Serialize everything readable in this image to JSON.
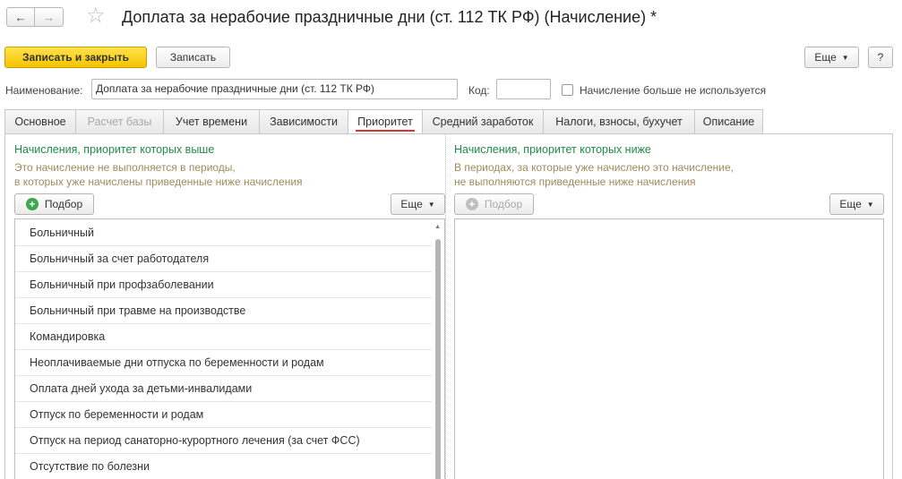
{
  "window": {
    "back_glyph": "←",
    "forward_glyph": "→",
    "star_glyph": "☆",
    "title": "Доплата за нерабочие праздничные дни (ст. 112 ТК РФ) (Начисление) *"
  },
  "toolbar": {
    "save_close_label": "Записать и закрыть",
    "save_label": "Записать",
    "more_label": "Еще",
    "help_label": "?"
  },
  "form": {
    "name_label": "Наименование:",
    "name_value": "Доплата за нерабочие праздничные дни (ст. 112 ТК РФ)",
    "code_label": "Код:",
    "code_value": "",
    "unused_label": "Начисление больше не используется",
    "unused_checked": false
  },
  "tabs": [
    {
      "label": "Основное",
      "state": "normal"
    },
    {
      "label": "Расчет базы",
      "state": "disabled"
    },
    {
      "label": "Учет времени",
      "state": "normal"
    },
    {
      "label": "Зависимости",
      "state": "normal"
    },
    {
      "label": "Приоритет",
      "state": "active"
    },
    {
      "label": "Средний заработок",
      "state": "normal"
    },
    {
      "label": "Налоги, взносы, бухучет",
      "state": "normal"
    },
    {
      "label": "Описание",
      "state": "normal"
    }
  ],
  "left": {
    "title": "Начисления, приоритет которых выше",
    "desc_line1": "Это начисление не выполняется в периоды,",
    "desc_line2": "в которых уже начислены приведенные ниже начисления",
    "pick_label": "Подбор",
    "more_label": "Еще",
    "items": [
      "Больничный",
      "Больничный за счет работодателя",
      "Больничный при профзаболевании",
      "Больничный при травме на производстве",
      "Командировка",
      "Неоплачиваемые дни отпуска по беременности и родам",
      "Оплата дней ухода за детьми-инвалидами",
      "Отпуск по беременности и родам",
      "Отпуск на период санаторно-курортного лечения (за счет ФСС)",
      "Отсутствие по болезни"
    ]
  },
  "right": {
    "title": "Начисления, приоритет которых ниже",
    "desc_line1": "В периодах, за которые уже начислено это начисление,",
    "desc_line2": "не выполняются приведенные ниже начисления",
    "pick_label": "Подбор",
    "more_label": "Еще",
    "items": []
  },
  "colors": {
    "accent_yellow": "#f5c400",
    "green_title": "#1f8a4c",
    "brown_text": "#a08a5a",
    "active_tab_underline": "#dd3333"
  }
}
